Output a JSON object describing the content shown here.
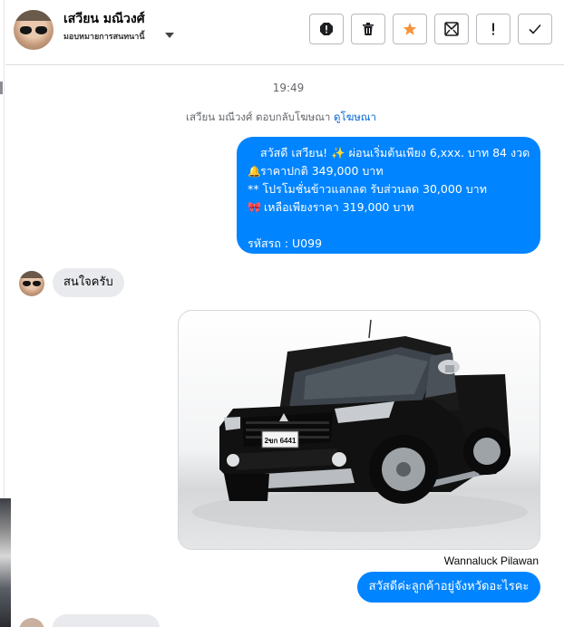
{
  "header": {
    "name": "เสวียน มณีวงศ์",
    "subtitle": "มอบหมายการสนทนานี้",
    "actions": [
      {
        "name": "report-icon",
        "label": "report"
      },
      {
        "name": "trash-icon",
        "label": "delete"
      },
      {
        "name": "star-icon",
        "label": "star"
      },
      {
        "name": "archive-icon",
        "label": "archive"
      },
      {
        "name": "exclamation-icon",
        "label": "mark important"
      },
      {
        "name": "checkmark-icon",
        "label": "done"
      }
    ],
    "star_color": "#f7923a"
  },
  "conversation": {
    "timestamp": "19:49",
    "reply_note": {
      "text": "เสวียน มณีวงศ์ ตอบกลับโฆษณา ",
      "link": "ดูโฆษณา"
    },
    "outgoing_ad_message": {
      "lines": [
        {
          "emoji": "",
          "text": "สวัสดี เสวียน! ✨  ผ่อนเริ่มต้นเพียง 6,xxx. บาท 84 งวด"
        },
        {
          "emoji": "🔔",
          "text": "ราคาปกติ 349,000 บาท"
        },
        {
          "emoji": "",
          "text": "** โปรโมชั่นข้าวแลกลด รับส่วนลด 30,000 บาท"
        },
        {
          "emoji": "🎀",
          "text": " เหลือเพียงราคา 319,000 บาท"
        },
        {
          "emoji": "",
          "text": ""
        },
        {
          "emoji": "",
          "text": "รหัสรถ : U099"
        }
      ],
      "bubble_color": "#0084ff"
    },
    "incoming_message": "สนใจครับ",
    "photo": {
      "license_plate": "2ขก 6441"
    },
    "sender_name": "Wannaluck Pilawan",
    "outgoing_reply": "สวัสดีค่ะลูกค้าอยู่จังหวัดอะไรคะ"
  }
}
